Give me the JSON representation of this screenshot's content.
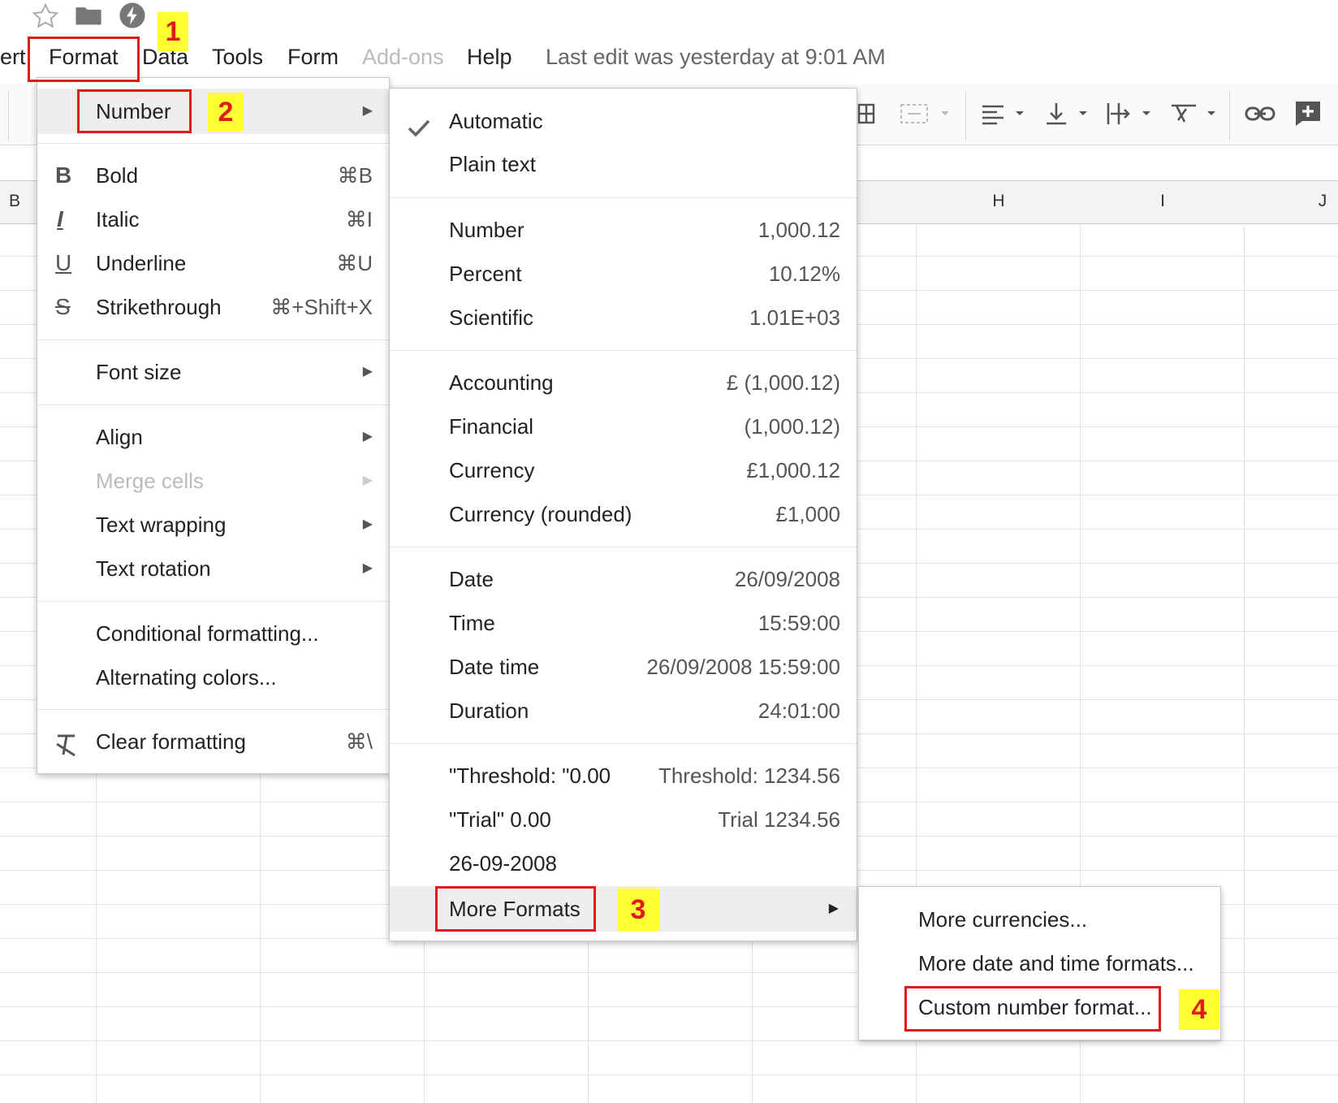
{
  "top_icons": [
    "star-icon",
    "folder-icon",
    "lightning-icon"
  ],
  "menubar": {
    "insert_partial": "ert",
    "format": "Format",
    "data": "Data",
    "tools": "Tools",
    "form": "Form",
    "addons": "Add-ons",
    "help": "Help",
    "last_edit": "Last edit was yesterday at 9:01 AM"
  },
  "columns": {
    "b": "B",
    "h": "H",
    "i": "I",
    "j": "J"
  },
  "format_menu": {
    "number": "Number",
    "bold": {
      "label": "Bold",
      "shortcut": "⌘B"
    },
    "italic": {
      "label": "Italic",
      "shortcut": "⌘I"
    },
    "underline": {
      "label": "Underline",
      "shortcut": "⌘U"
    },
    "strikethrough": {
      "label": "Strikethrough",
      "shortcut": "⌘+Shift+X"
    },
    "font_size": "Font size",
    "align": "Align",
    "merge_cells": "Merge cells",
    "text_wrapping": "Text wrapping",
    "text_rotation": "Text rotation",
    "conditional_formatting": "Conditional formatting...",
    "alternating_colors": "Alternating colors...",
    "clear_formatting": {
      "label": "Clear formatting",
      "shortcut": "⌘\\"
    }
  },
  "number_menu": {
    "automatic": "Automatic",
    "plain_text": "Plain text",
    "number": {
      "label": "Number",
      "example": "1,000.12"
    },
    "percent": {
      "label": "Percent",
      "example": "10.12%"
    },
    "scientific": {
      "label": "Scientific",
      "example": "1.01E+03"
    },
    "accounting": {
      "label": "Accounting",
      "example": "£ (1,000.12)"
    },
    "financial": {
      "label": "Financial",
      "example": "(1,000.12)"
    },
    "currency": {
      "label": "Currency",
      "example": "£1,000.12"
    },
    "currency_rounded": {
      "label": "Currency (rounded)",
      "example": "£1,000"
    },
    "date": {
      "label": "Date",
      "example": "26/09/2008"
    },
    "time": {
      "label": "Time",
      "example": "15:59:00"
    },
    "date_time": {
      "label": "Date time",
      "example": "26/09/2008 15:59:00"
    },
    "duration": {
      "label": "Duration",
      "example": "24:01:00"
    },
    "threshold": {
      "label": "\"Threshold: \"0.00",
      "example": "Threshold: 1234.56"
    },
    "trial": {
      "label": "\"Trial\" 0.00",
      "example": "Trial 1234.56"
    },
    "date_custom": {
      "label": "26-09-2008"
    },
    "more_formats": "More Formats"
  },
  "more_formats_menu": {
    "more_currencies": "More currencies...",
    "more_date_time": "More date and time formats...",
    "custom_number": "Custom number format..."
  },
  "steps": [
    "1",
    "2",
    "3",
    "4"
  ],
  "colors": {
    "highlight_box": "#e01b1b",
    "badge_bg": "#ffff33",
    "menu_hover": "#eeeeee"
  }
}
